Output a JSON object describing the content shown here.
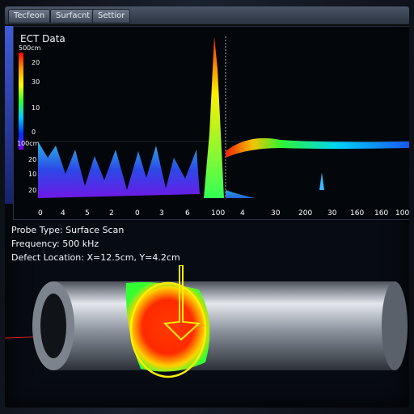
{
  "tabs": [
    "Tecfeon",
    "Surfacnt",
    "Settior"
  ],
  "panel_title": "ECT Data",
  "colorbar": {
    "top_label": "500cm",
    "bottom_label": "100cm",
    "ticks": [
      "20",
      "30",
      "10",
      "0"
    ]
  },
  "y_ticks": [
    "20",
    "10",
    "20",
    "10",
    "20"
  ],
  "x_ticks": [
    "0",
    "4",
    "5",
    "2",
    "0",
    "3",
    "6",
    "100",
    "4",
    "30",
    "200",
    "30",
    "160",
    "160",
    "100"
  ],
  "info": {
    "probe": "Probe Type: Surface Scan",
    "frequency": "Frequency: 500 kHz",
    "defect": "Defect Location: X=12.5cm, Y=4.2cm"
  },
  "colors": {
    "accent": "#ffee00",
    "defect": "#ff2a00",
    "background": "#05080e"
  }
}
